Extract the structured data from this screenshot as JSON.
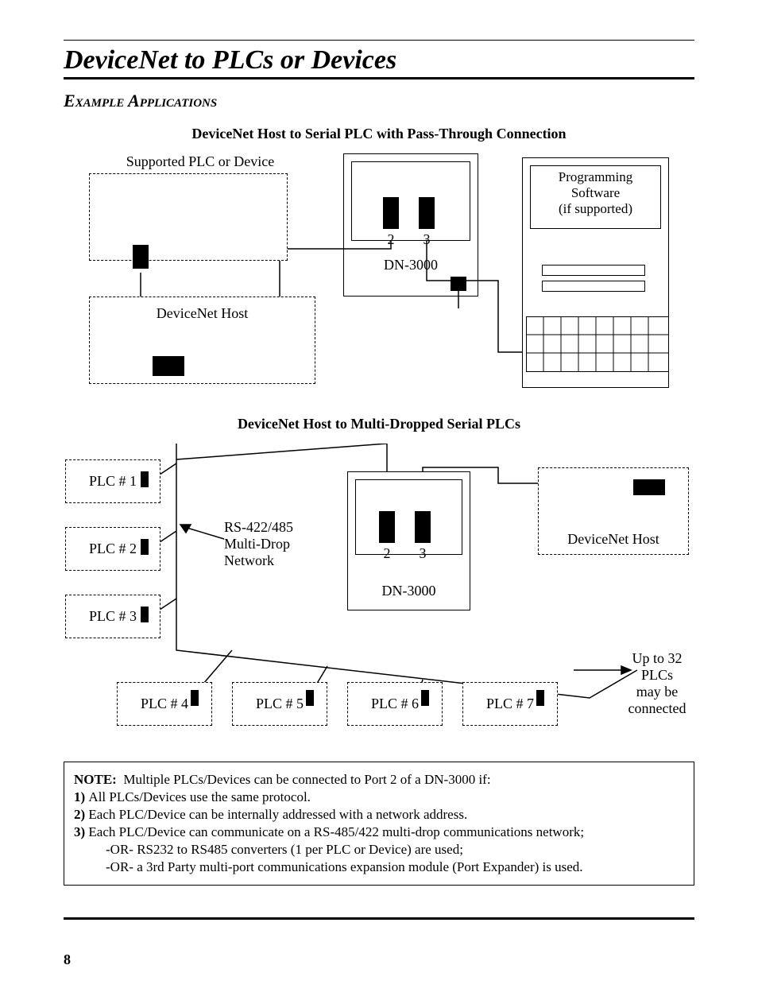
{
  "header": {
    "title": "DeviceNet to PLCs or Devices",
    "subtitle": "Example Applications"
  },
  "figure1": {
    "title": "DeviceNet Host to Serial PLC with Pass-Through Connection",
    "plc_label": "Supported PLC or Device",
    "dn3000_label": "DN-3000",
    "port2": "2",
    "port3": "3",
    "host_label": "DeviceNet Host",
    "sw_label": "Programming\nSoftware\n(if supported)"
  },
  "figure2": {
    "title": "DeviceNet Host to Multi-Dropped Serial PLCs",
    "plc1": "PLC # 1",
    "plc2": "PLC # 2",
    "plc3": "PLC # 3",
    "plc4": "PLC # 4",
    "plc5": "PLC # 5",
    "plc6": "PLC # 6",
    "plc7": "PLC # 7",
    "network_label": "RS-422/485\nMulti-Drop\nNetwork",
    "dn3000_label": "DN-3000",
    "port2": "2",
    "port3": "3",
    "host_label": "DeviceNet Host",
    "limit_label": "Up to 32\nPLCs\nmay be\nconnected"
  },
  "note": {
    "lead": "NOTE:",
    "lead_text": "Multiple PLCs/Devices can be connected to Port 2 of a DN-3000 if:",
    "i1_num": "1)",
    "i1": "All PLCs/Devices use the same protocol.",
    "i2_num": "2)",
    "i2": "Each PLC/Device can be internally addressed with a network address.",
    "i3_num": "3)",
    "i3": "Each PLC/Device can communicate on a RS-485/422 multi-drop communications network;",
    "i3b": "-OR- RS232 to RS485 converters (1 per PLC or Device) are used;",
    "i3c": "-OR- a 3rd Party multi-port communications expansion module (Port Expander) is used."
  },
  "page_number": "8"
}
